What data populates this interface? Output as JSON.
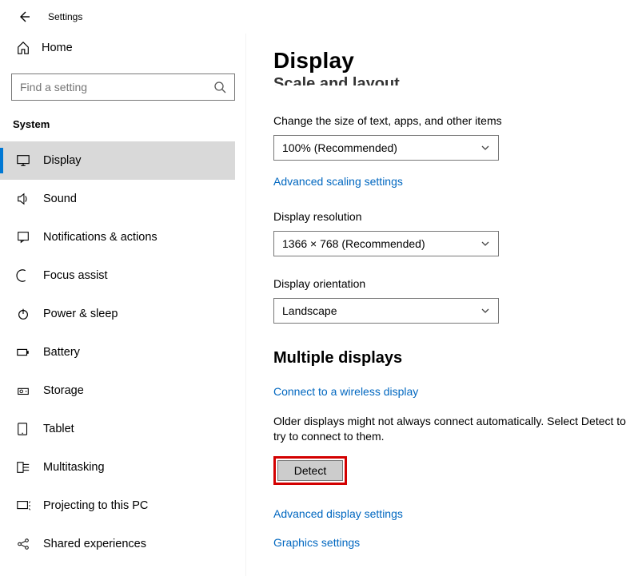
{
  "header": {
    "title": "Settings"
  },
  "sidebar": {
    "home_label": "Home",
    "search_placeholder": "Find a setting",
    "category_label": "System",
    "items": [
      {
        "label": "Display",
        "icon": "display"
      },
      {
        "label": "Sound",
        "icon": "sound"
      },
      {
        "label": "Notifications & actions",
        "icon": "notifications"
      },
      {
        "label": "Focus assist",
        "icon": "focus"
      },
      {
        "label": "Power & sleep",
        "icon": "power"
      },
      {
        "label": "Battery",
        "icon": "battery"
      },
      {
        "label": "Storage",
        "icon": "storage"
      },
      {
        "label": "Tablet",
        "icon": "tablet"
      },
      {
        "label": "Multitasking",
        "icon": "multitasking"
      },
      {
        "label": "Projecting to this PC",
        "icon": "projecting"
      },
      {
        "label": "Shared experiences",
        "icon": "shared"
      }
    ]
  },
  "main": {
    "page_title": "Display",
    "section_scale": "Scale and layout",
    "scale_label": "Change the size of text, apps, and other items",
    "scale_value": "100% (Recommended)",
    "advanced_scaling_link": "Advanced scaling settings",
    "resolution_label": "Display resolution",
    "resolution_value": "1366 × 768 (Recommended)",
    "orientation_label": "Display orientation",
    "orientation_value": "Landscape",
    "multi_title": "Multiple displays",
    "wireless_link": "Connect to a wireless display",
    "detect_text": "Older displays might not always connect automatically. Select Detect to try to connect to them.",
    "detect_label": "Detect",
    "advanced_display_link": "Advanced display settings",
    "graphics_link": "Graphics settings"
  }
}
